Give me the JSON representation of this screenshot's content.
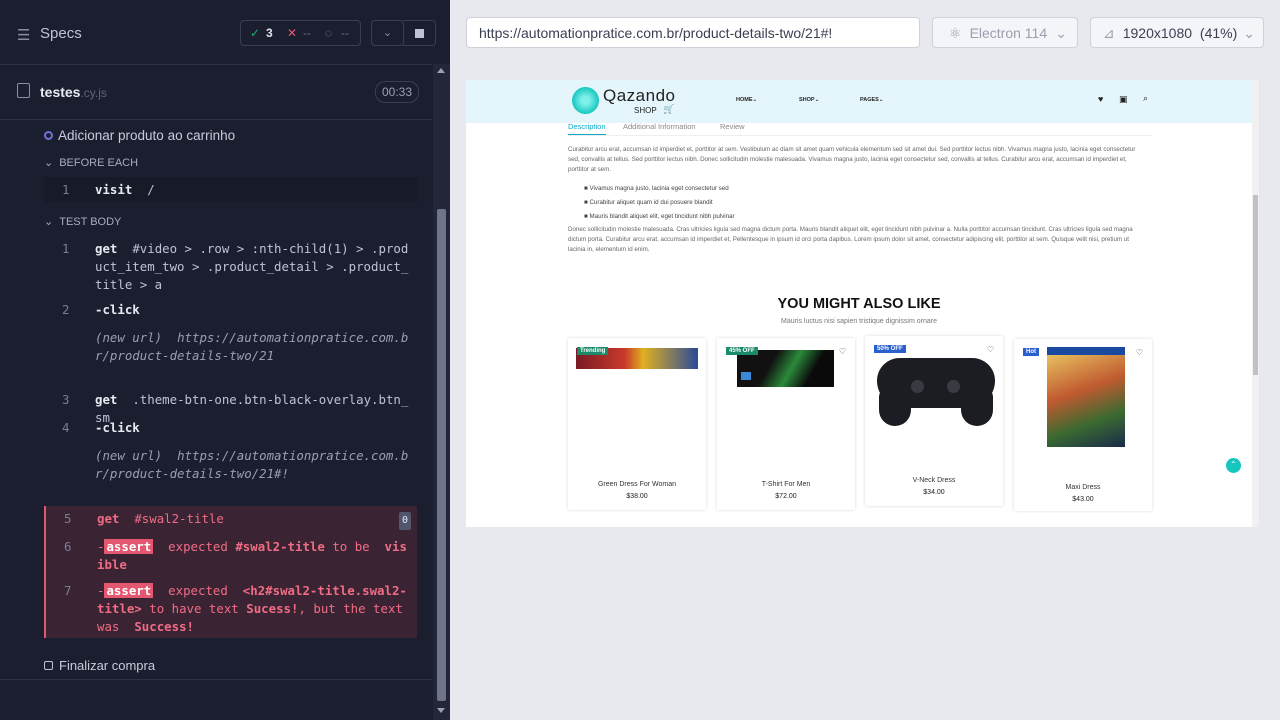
{
  "runner": {
    "specs_label": "Specs",
    "stats": {
      "passed": "3",
      "failed": "--",
      "pending": "--"
    },
    "file": {
      "name": "testes",
      "ext": ".cy.js",
      "duration": "00:33"
    },
    "test_title": "Adicionar produto ao carrinho",
    "before_each_label": "BEFORE EACH",
    "before_each": [
      {
        "n": "1",
        "cmd": "visit",
        "arg": "/"
      }
    ],
    "test_body_label": "TEST BODY",
    "commands": [
      {
        "n": "1",
        "cmd": "get",
        "arg": "#video > .row > :nth-child(1) > .product_item_two > .product_detail > .product_title > a"
      },
      {
        "n": "2",
        "cmd": "-click",
        "arg": ""
      },
      {
        "n": "",
        "cmd": "(new url)",
        "arg": "https://automationpratice.com.br/product-details-two/21"
      },
      {
        "n": "3",
        "cmd": "get",
        "arg": ".theme-btn-one.btn-black-overlay.btn_sm"
      },
      {
        "n": "4",
        "cmd": "-click",
        "arg": ""
      },
      {
        "n": "",
        "cmd": "(new url)",
        "arg": "https://automationpratice.com.br/product-details-two/21#!"
      }
    ],
    "failed_cmd": {
      "n": "5",
      "cmd": "get",
      "arg": "#swal2-title",
      "count": "0"
    },
    "assert1": {
      "n": "6",
      "prefix": "-",
      "tag": "assert",
      "text1": "expected",
      "sel": "#swal2-title",
      "text2": "to be",
      "text3": "visible"
    },
    "assert2": {
      "n": "7",
      "prefix": "-",
      "tag": "assert",
      "text1": "expected",
      "sel": "<h2#swal2-title.swal2-title>",
      "text2": "to have text",
      "exp": "Sucess!",
      "text3": ", but the text was",
      "act": "Success!"
    },
    "next_test": "Finalizar compra"
  },
  "browser": {
    "url": "https://automationpratice.com.br/product-details-two/21#!",
    "engine": "Electron 114",
    "viewport": "1920x1080",
    "zoom": "(41%)"
  },
  "site": {
    "logo_main": "Qazando",
    "logo_sub": "SHOP",
    "nav": [
      "HOME",
      "SHOP",
      "PAGES"
    ],
    "tabs": [
      "Description",
      "Additional Information",
      "Review"
    ],
    "para1": "Curabitur arcu erat, accumsan id imperdiet et, porttitor at sem. Vestibulum ac diam sit amet quam vehicula elementum sed sit amet dui. Sed porttitor lectus nibh. Vivamus magna justo, lacinia eget consectetur sed, convallis at tellus. Sed porttitor lectus nibh. Donec sollicitudin molestie malesuada. Vivamus magna justo, lacinia eget consectetur sed, convallis at tellus. Curabitur arcu erat, accumsan id imperdiet et, porttitor at sem.",
    "bullets": [
      "Vivamus magna justo, lacinia eget consectetur sed",
      "Curabitur aliquet quam id dui posuere blandit",
      "Mauris blandit aliquet elit, eget tincidunt nibh pulvinar"
    ],
    "para2": "Donec sollicitudin molestie malesuada. Cras ultricies ligula sed magna dictum porta. Mauris blandit aliquet elit, eget tincidunt nibh pulvinar a. Nulla porttitor accumsan tincidunt. Cras ultricies ligula sed magna dictum porta. Curabitur arcu erat, accumsan id imperdiet et, Pellentesque in ipsum id orci porta dapibus. Lorem ipsum dolor sit amet, consectetur adipiscing elit, porttitor at sem. Quisque velit nisi, pretium ut lacinia in, elementum id enim.",
    "section_title": "YOU MIGHT ALSO LIKE",
    "section_sub": "Mauris luctus nisi sapien tristique dignissim ornare",
    "products": [
      {
        "badge": "Trending",
        "name": "Green Dress For Woman",
        "price": "$38.00"
      },
      {
        "badge": "45% OFF",
        "name": "T-Shirt For Men",
        "price": "$72.00"
      },
      {
        "badge": "50% OFF",
        "name": "V-Neck Dress",
        "price": "$34.00"
      },
      {
        "badge": "Hot",
        "name": "Maxi Dress",
        "price": "$43.00"
      }
    ]
  },
  "colors": {
    "pass": "#1fa971",
    "fail": "#e45770",
    "accent": "#00c3c3"
  }
}
